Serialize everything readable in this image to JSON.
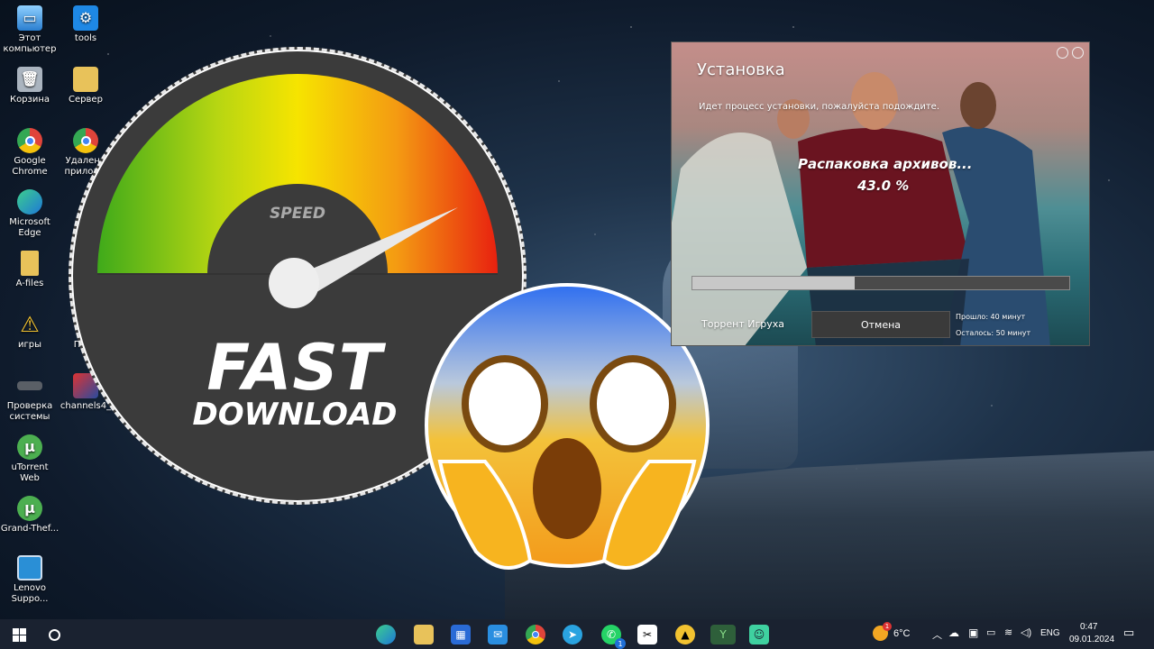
{
  "desktop": {
    "icons": [
      {
        "label": "Этот компьютер",
        "icon": "computer-icon",
        "color": "#4fa3e0"
      },
      {
        "label": "tools",
        "icon": "gear-icon",
        "color": "#1e88e5"
      },
      {
        "label": "Корзина",
        "icon": "recycle-bin-icon",
        "color": "#9aa4ae"
      },
      {
        "label": "Сервер",
        "icon": "folder-icon",
        "color": "#e8c25a"
      },
      {
        "label": "Google Chrome",
        "icon": "chrome-icon",
        "color": "#e0443a"
      },
      {
        "label": "Удаленн приложе",
        "icon": "chrome-icon",
        "color": "#e0443a"
      },
      {
        "label": "Microsoft Edge",
        "icon": "edge-icon",
        "color": "#1e9bd7"
      },
      {
        "label": "A-files",
        "icon": "file-icon",
        "color": "#e8c25a"
      },
      {
        "label": "игры",
        "icon": "warning-icon",
        "color": "#f2c230"
      },
      {
        "label": "Папр",
        "icon": "folder-icon",
        "color": "#e8c25a"
      },
      {
        "label": "Проверка системы",
        "icon": "chip-icon",
        "color": "#5a5f66"
      },
      {
        "label": "channels4_",
        "icon": "image-icon",
        "color": "#3d5a9e"
      },
      {
        "label": "uTorrent Web",
        "icon": "utorrent-icon",
        "color": "#4caf50"
      },
      {
        "label": "Grand-Thef...",
        "icon": "utorrent-icon",
        "color": "#4caf50"
      },
      {
        "label": "Lenovo Suppo...",
        "icon": "lenovo-icon",
        "color": "#2a8fd6"
      }
    ]
  },
  "speedometer": {
    "label": "SPEED",
    "title_line1": "FAST",
    "title_line2": "DOWNLOAD"
  },
  "installer": {
    "title": "Установка",
    "subtitle": "Идет процесс установки, пожалуйста подождите.",
    "status": "Распаковка архивов...",
    "percent_text": "43.0 %",
    "progress": 0.43,
    "publisher": "Торрент Игруха",
    "cancel_label": "Отмена",
    "elapsed": "Прошло:  40 минут",
    "remaining": "Осталось:  50 минут"
  },
  "taskbar": {
    "apps": [
      "windows-icon",
      "search-icon",
      "edge-icon",
      "explorer-icon",
      "store-icon",
      "mail-icon",
      "chrome-icon",
      "telegram-icon",
      "whatsapp-icon",
      "capcut-icon",
      "app-icon",
      "terminal-icon",
      "discord-icon"
    ],
    "whatsapp_badge": "1",
    "weather_temp": "6°C",
    "weather_badge": "1",
    "language": "ENG",
    "time": "0:47",
    "date": "09.01.2024"
  }
}
